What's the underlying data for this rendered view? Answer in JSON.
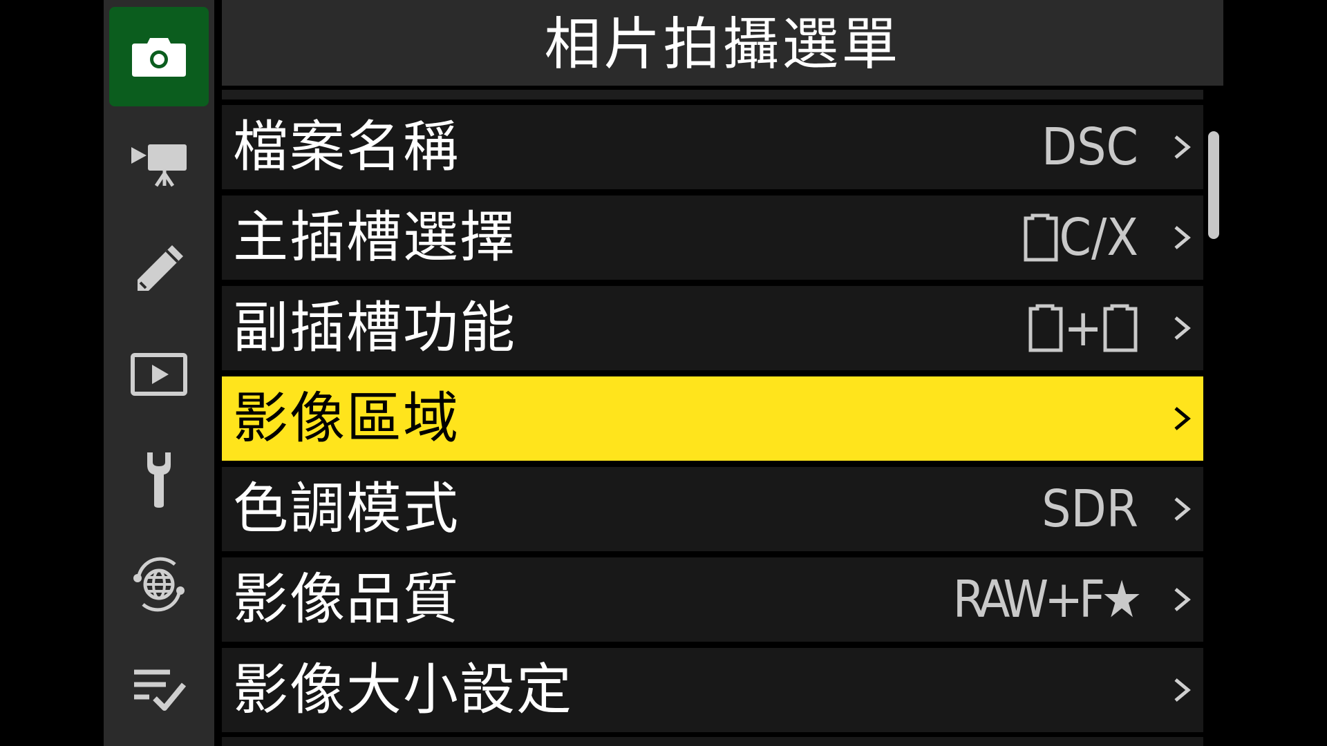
{
  "header": {
    "title": "相片拍攝選單"
  },
  "rail": {
    "tabs": [
      {
        "icon": "camera-icon",
        "active": true
      },
      {
        "icon": "movie-camera-icon",
        "active": false
      },
      {
        "icon": "pencil-icon",
        "active": false
      },
      {
        "icon": "playback-icon",
        "active": false
      },
      {
        "icon": "wrench-icon",
        "active": false
      },
      {
        "icon": "network-icon",
        "active": false
      },
      {
        "icon": "my-menu-icon",
        "active": false
      }
    ]
  },
  "menu": {
    "items": [
      {
        "label": "檔案名稱",
        "value": "DSC",
        "value_icon": "",
        "selected": false
      },
      {
        "label": "主插槽選擇",
        "value": "C/X",
        "value_icon": "card-slot-icon",
        "selected": false
      },
      {
        "label": "副插槽功能",
        "value": "+",
        "value_icon": "card-plus-card-icon",
        "selected": false
      },
      {
        "label": "影像區域",
        "value": "",
        "value_icon": "",
        "selected": true
      },
      {
        "label": "色調模式",
        "value": "SDR",
        "value_icon": "",
        "selected": false
      },
      {
        "label": "影像品質",
        "value": "RAW+F★",
        "value_icon": "",
        "selected": false
      },
      {
        "label": "影像大小設定",
        "value": "",
        "value_icon": "",
        "selected": false
      }
    ]
  },
  "scrollbar": {
    "position": 0.0
  },
  "colors": {
    "selected_row": "#ffe41c",
    "active_tab": "#0b5d1e",
    "row_bg": "#181818",
    "rail_bg": "#2b2b2b"
  }
}
